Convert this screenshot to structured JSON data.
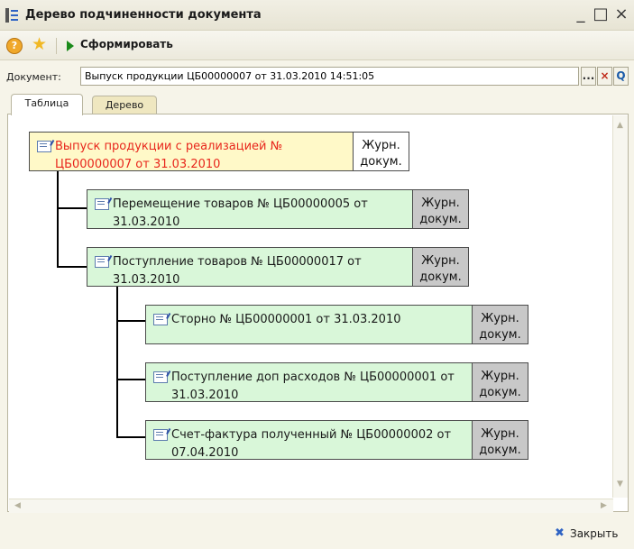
{
  "window": {
    "title": "Дерево подчиненности документа",
    "minimize": "_",
    "maximize": "□",
    "close": "×"
  },
  "toolbar": {
    "help_label": "?",
    "favorite_icon": "★",
    "form_label": "Сформировать"
  },
  "document": {
    "label": "Документ:",
    "value": "Выпуск продукции ЦБ00000007 от 31.03.2010 14:51:05",
    "select_label": "...",
    "clear_label": "×",
    "open_label": "Q"
  },
  "tabs": [
    {
      "label": "Таблица",
      "active": true
    },
    {
      "label": "Дерево",
      "active": false
    }
  ],
  "tree": {
    "journal_label": "Журн. докум.",
    "nodes": [
      {
        "title": "Выпуск продукции с реализацией № ЦБ00000007 от 31.03.2010",
        "level": 0
      },
      {
        "title": "Перемещение товаров № ЦБ00000005 от 31.03.2010",
        "level": 1
      },
      {
        "title": "Поступление товаров № ЦБ00000017 от 31.03.2010",
        "level": 1
      },
      {
        "title": "Сторно № ЦБ00000001 от 31.03.2010",
        "level": 2
      },
      {
        "title": "Поступление доп расходов № ЦБ00000001 от 31.03.2010",
        "level": 2
      },
      {
        "title": "Счет-фактура полученный № ЦБ00000002 от 07.04.2010",
        "level": 2
      }
    ]
  },
  "footer": {
    "close_label": "Закрыть"
  },
  "colors": {
    "root_bg": "#fff9c8",
    "root_text": "#e8261c",
    "child_bg": "#d9f7d9",
    "journal_bg": "#c8c8c8"
  }
}
